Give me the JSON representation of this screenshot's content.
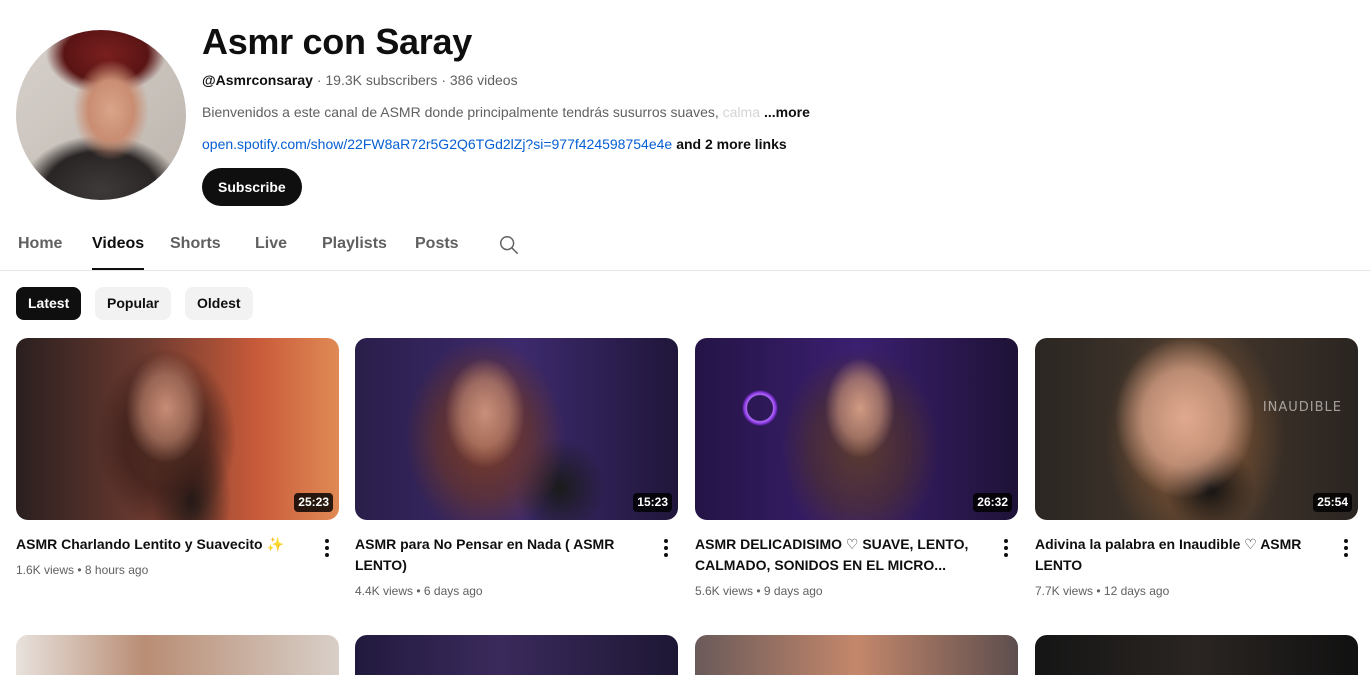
{
  "channel": {
    "name": "Asmr con Saray",
    "handle": "@Asmrconsaray",
    "stats": " · 19.3K subscribers · 386 videos",
    "description": "Bienvenidos a este canal de ASMR donde principalmente tendrás susurros suaves, ",
    "description_fade": "calma",
    "description_more": "...more",
    "link": "open.spotify.com/show/22FW8aR72r5G2Q6TGd2lZj?si=977f424598754e4e",
    "more_links": "and 2 more links",
    "subscribe_label": "Subscribe"
  },
  "tabs": [
    {
      "label": "Home"
    },
    {
      "label": "Videos",
      "active": true
    },
    {
      "label": "Shorts"
    },
    {
      "label": "Live"
    },
    {
      "label": "Playlists"
    },
    {
      "label": "Posts"
    }
  ],
  "search_icon": "search-icon",
  "chips": [
    {
      "label": "Latest",
      "active": true
    },
    {
      "label": "Popular"
    },
    {
      "label": "Oldest"
    }
  ],
  "videos": [
    {
      "title": "ASMR Charlando Lentito y Suavecito ✨",
      "duration": "25:23",
      "meta": "1.6K views • 8 hours ago"
    },
    {
      "title": "ASMR para No Pensar en Nada ( ASMR LENTO)",
      "duration": "15:23",
      "meta": "4.4K views • 6 days ago"
    },
    {
      "title": "ASMR DELICADISIMO ♡ SUAVE, LENTO, CALMADO, SONIDOS EN EL MICRO...",
      "duration": "26:32",
      "meta": "5.6K views • 9 days ago"
    },
    {
      "title": "Adivina la palabra en Inaudible ♡ ASMR LENTO",
      "duration": "25:54",
      "meta": "7.7K views • 12 days ago",
      "watermark": "INAUDIBLE"
    }
  ],
  "colors": {
    "accent": "#0f0f0f",
    "link": "#065fd4",
    "muted": "#606060"
  }
}
